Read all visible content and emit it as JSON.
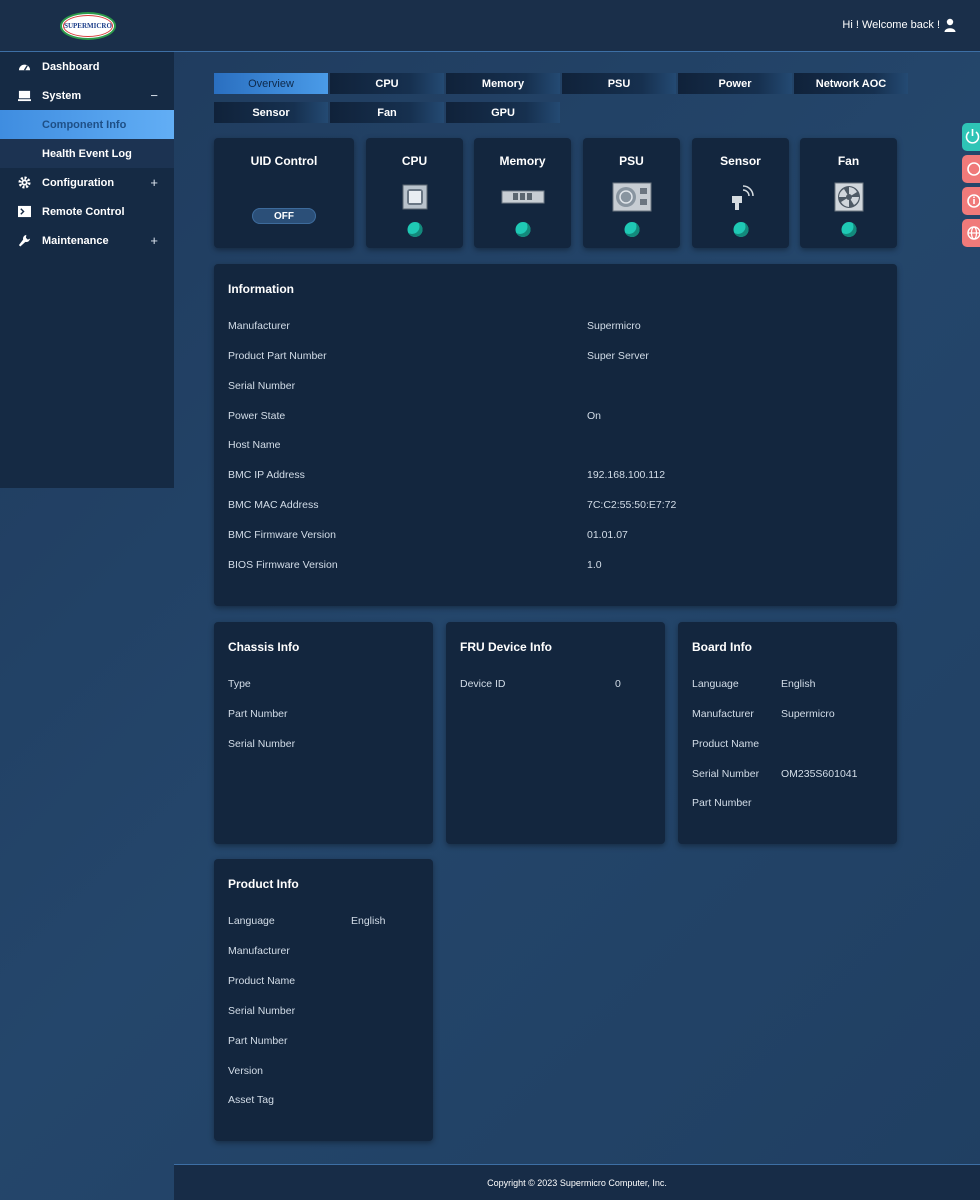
{
  "header": {
    "logo_text": "SUPERMICRO",
    "welcome": "Hi ! Welcome back !"
  },
  "sidebar": {
    "items": [
      {
        "label": "Dashboard",
        "icon": "dashboard-icon"
      },
      {
        "label": "System",
        "icon": "monitor-icon",
        "toggle": "−"
      },
      {
        "label": "Component Info",
        "sub": true,
        "active": true
      },
      {
        "label": "Health Event Log",
        "sub": true
      },
      {
        "label": "Configuration",
        "icon": "gear-icon",
        "toggle": "+"
      },
      {
        "label": "Remote Control",
        "icon": "terminal-icon"
      },
      {
        "label": "Maintenance",
        "icon": "wrench-icon",
        "toggle": "+"
      }
    ]
  },
  "tabs": [
    "Overview",
    "CPU",
    "Memory",
    "PSU",
    "Power",
    "Network AOC",
    "Sensor",
    "Fan",
    "GPU"
  ],
  "uid": {
    "title": "UID Control",
    "state": "OFF"
  },
  "tiles": [
    {
      "title": "CPU",
      "icon": "cpu-icon"
    },
    {
      "title": "Memory",
      "icon": "memory-icon"
    },
    {
      "title": "PSU",
      "icon": "psu-icon"
    },
    {
      "title": "Sensor",
      "icon": "sensor-icon"
    },
    {
      "title": "Fan",
      "icon": "fan-icon"
    }
  ],
  "information": {
    "title": "Information",
    "rows": [
      {
        "label": "Manufacturer",
        "value": "Supermicro"
      },
      {
        "label": "Product Part Number",
        "value": "Super Server"
      },
      {
        "label": "Serial Number",
        "value": ""
      },
      {
        "label": "Power State",
        "value": "On"
      },
      {
        "label": "Host Name",
        "value": ""
      },
      {
        "label": "BMC IP Address",
        "value": "192.168.100.112"
      },
      {
        "label": "BMC MAC Address",
        "value": "7C:C2:55:50:E7:72"
      },
      {
        "label": "BMC Firmware Version",
        "value": "01.01.07"
      },
      {
        "label": "BIOS Firmware Version",
        "value": "1.0"
      }
    ]
  },
  "chassis": {
    "title": "Chassis Info",
    "rows": [
      {
        "label": "Type",
        "value": ""
      },
      {
        "label": "Part Number",
        "value": ""
      },
      {
        "label": "Serial Number",
        "value": ""
      }
    ]
  },
  "fru": {
    "title": "FRU Device Info",
    "rows": [
      {
        "label": "Device ID",
        "value": "0"
      }
    ]
  },
  "board": {
    "title": "Board Info",
    "rows": [
      {
        "label": "Language",
        "value": "English"
      },
      {
        "label": "Manufacturer",
        "value": "Supermicro"
      },
      {
        "label": "Product Name",
        "value": ""
      },
      {
        "label": "Serial Number",
        "value": "OM235S601041"
      },
      {
        "label": "Part Number",
        "value": ""
      }
    ]
  },
  "product": {
    "title": "Product Info",
    "rows": [
      {
        "label": "Language",
        "value": "English"
      },
      {
        "label": "Manufacturer",
        "value": ""
      },
      {
        "label": "Product Name",
        "value": ""
      },
      {
        "label": "Serial Number",
        "value": ""
      },
      {
        "label": "Part Number",
        "value": ""
      },
      {
        "label": "Version",
        "value": ""
      },
      {
        "label": "Asset Tag",
        "value": ""
      }
    ]
  },
  "float_buttons": [
    {
      "icon": "power-icon",
      "color": "#2ec4b6"
    },
    {
      "icon": "refresh-icon",
      "color": "#f07a7a"
    },
    {
      "icon": "info-icon",
      "color": "#f07a7a"
    },
    {
      "icon": "globe-icon",
      "color": "#f07a7a"
    }
  ],
  "footer": {
    "copyright": "Copyright © 2023 Supermicro Computer, Inc."
  }
}
